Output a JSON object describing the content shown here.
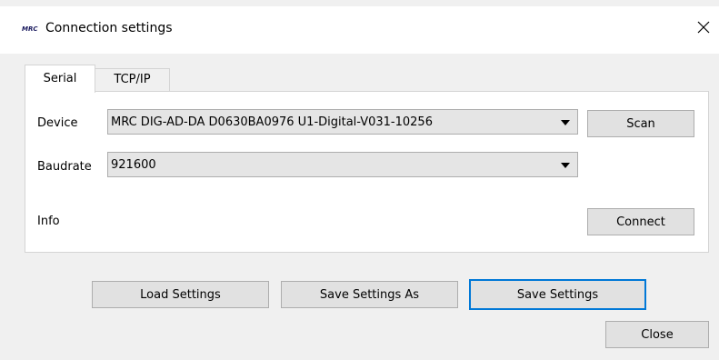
{
  "window": {
    "title": "Connection settings",
    "logo_text": "MRC",
    "accent_color": "#0078d7"
  },
  "icons": {
    "close": "close-icon",
    "logo": "mrc-logo-icon",
    "dropdown": "chevron-down-icon"
  },
  "tabs": [
    {
      "label": "Serial",
      "active": true
    },
    {
      "label": "TCP/IP",
      "active": false
    }
  ],
  "serial": {
    "device_label": "Device",
    "device_value": "MRC DIG-AD-DA D0630BA0976 U1-Digital-V031-10256",
    "scan_label": "Scan",
    "baudrate_label": "Baudrate",
    "baudrate_value": "921600",
    "info_label": "Info",
    "connect_label": "Connect"
  },
  "actions": {
    "load_label": "Load Settings",
    "save_as_label": "Save Settings As",
    "save_label": "Save Settings",
    "close_label": "Close"
  }
}
